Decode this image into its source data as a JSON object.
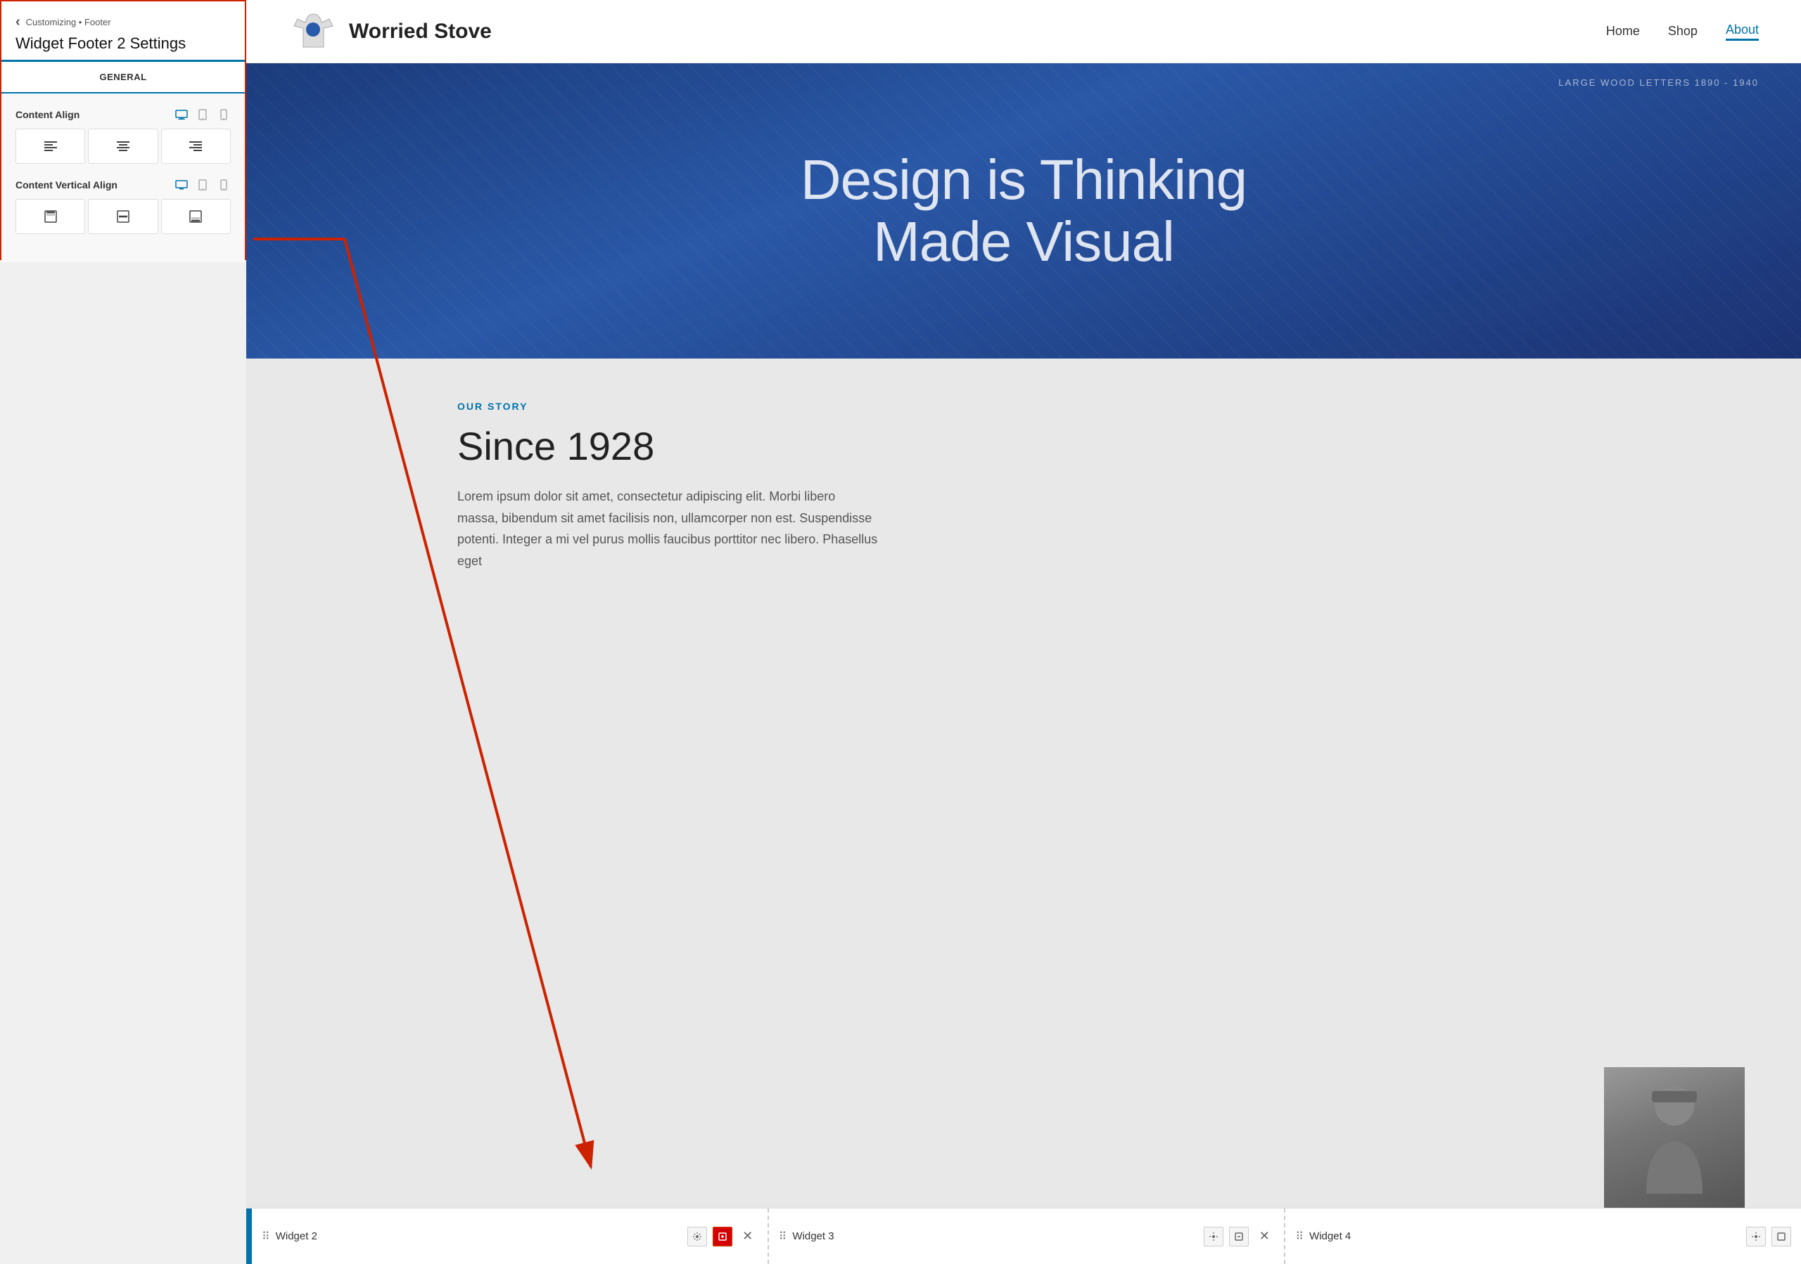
{
  "panel": {
    "breadcrumb": "Customizing • Footer",
    "title": "Widget Footer 2 Settings",
    "general_tab": "GENERAL",
    "back_arrow": "‹",
    "content_align_label": "Content Align",
    "content_vertical_align_label": "Content Vertical Align",
    "device_icons": [
      "desktop",
      "tablet",
      "mobile"
    ],
    "align_buttons": [
      "left",
      "center",
      "right"
    ],
    "vertical_align_buttons": [
      "top",
      "middle",
      "bottom"
    ]
  },
  "site": {
    "name": "Worried Stove",
    "nav_links": [
      {
        "label": "Home",
        "active": false
      },
      {
        "label": "Shop",
        "active": false
      },
      {
        "label": "About",
        "active": true
      }
    ],
    "hero": {
      "bg_text": "LARGE WOOD LETTERS 1890 - 1940",
      "title_line1": "Design is Thinking",
      "title_line2": "Made Visual"
    },
    "content": {
      "section_label": "OUR STORY",
      "title": "Since 1928",
      "body": "Lorem ipsum dolor sit amet, consectetur adipiscing elit. Morbi libero massa, bibendum sit amet facilisis non, ullamcorper non est. Suspendisse potenti. Integer a mi vel purus mollis faucibus porttitor nec libero. Phasellus eget"
    }
  },
  "footer_widgets": [
    {
      "id": "widget-2",
      "name": "Widget 2",
      "active": true
    },
    {
      "id": "widget-3",
      "name": "Widget 3",
      "active": false
    },
    {
      "id": "widget-4",
      "name": "Widget 4",
      "active": false
    }
  ]
}
